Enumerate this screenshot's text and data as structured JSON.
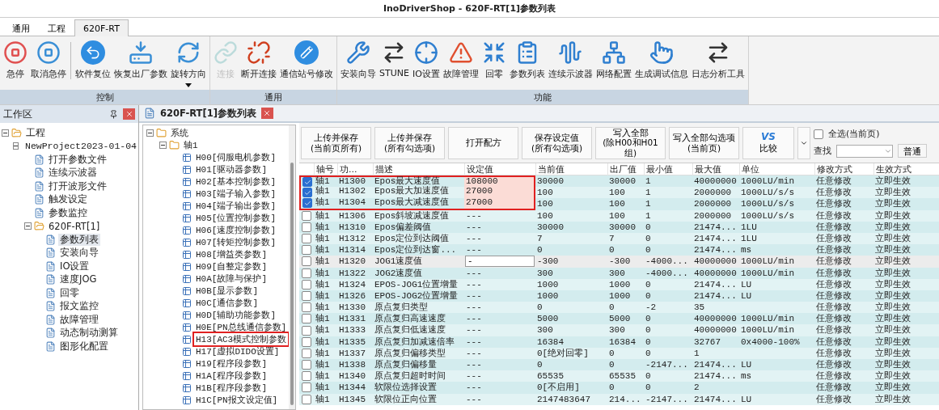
{
  "window": {
    "title": "InoDriverShop - 620F-RT[1]参数列表"
  },
  "menu_tabs": [
    {
      "label": "通用",
      "selected": false
    },
    {
      "label": "工程",
      "selected": false
    },
    {
      "label": "620F-RT",
      "selected": true
    }
  ],
  "ribbon": [
    {
      "label": "控制",
      "items": [
        {
          "label": "急停",
          "disabled": false
        },
        {
          "label": "取消急停",
          "disabled": false
        },
        {
          "label": "软件复位",
          "disabled": false
        },
        {
          "label": "恢复出厂参数",
          "disabled": false
        },
        {
          "label": "旋转方向",
          "disabled": false,
          "menu": true
        }
      ]
    },
    {
      "label": "通用",
      "items": [
        {
          "label": "连接",
          "disabled": true
        },
        {
          "label": "断开连接",
          "disabled": false
        },
        {
          "label": "通信站号修改",
          "disabled": false
        }
      ]
    },
    {
      "label": "功能",
      "items": [
        {
          "label": "安装向导",
          "disabled": false
        },
        {
          "label": "STUNE",
          "disabled": false
        },
        {
          "label": "IO设置",
          "disabled": false
        },
        {
          "label": "故障管理",
          "disabled": false
        },
        {
          "label": "回零",
          "disabled": false
        },
        {
          "label": "参数列表",
          "disabled": false
        },
        {
          "label": "连续示波器",
          "disabled": false
        },
        {
          "label": "网络配置",
          "disabled": false
        },
        {
          "label": "生成调试信息",
          "disabled": false
        },
        {
          "label": "日志分析工具",
          "disabled": false
        }
      ]
    }
  ],
  "workspace": {
    "title": "工作区",
    "tree": [
      {
        "label": "工程",
        "selected": false,
        "expanded": true,
        "children": [
          {
            "label": "NewProject2023-01-04",
            "selected": false,
            "expanded": true,
            "children": [
              {
                "label": "打开参数文件",
                "selected": false
              },
              {
                "label": "连续示波器",
                "selected": false
              },
              {
                "label": "打开波形文件",
                "selected": false
              },
              {
                "label": "触发设定",
                "selected": false
              },
              {
                "label": "参数监控",
                "selected": false
              },
              {
                "label": "620F-RT[1]",
                "selected": false,
                "expanded": true,
                "children": [
                  {
                    "label": "参数列表",
                    "selected": true
                  },
                  {
                    "label": "安装向导",
                    "selected": false
                  },
                  {
                    "label": "IO设置",
                    "selected": false
                  },
                  {
                    "label": "速度JOG",
                    "selected": false
                  },
                  {
                    "label": "回零",
                    "selected": false
                  },
                  {
                    "label": "报文监控",
                    "selected": false
                  },
                  {
                    "label": "故障管理",
                    "selected": false
                  },
                  {
                    "label": "动态制动测算",
                    "selected": false
                  },
                  {
                    "label": "图形化配置",
                    "selected": false
                  }
                ]
              }
            ]
          }
        ]
      }
    ]
  },
  "document": {
    "title": "620F-RT[1]参数列表"
  },
  "group_tree": [
    {
      "label": "系统",
      "expanded": true,
      "marked": false,
      "children": [
        {
          "label": "轴1",
          "expanded": true,
          "marked": false,
          "children": [
            {
              "label": "H00[伺服电机参数]",
              "marked": false
            },
            {
              "label": "H01[驱动器参数]",
              "marked": false
            },
            {
              "label": "H02[基本控制参数]",
              "marked": false
            },
            {
              "label": "H03[端子输入参数]",
              "marked": false
            },
            {
              "label": "H04[端子输出参数]",
              "marked": false
            },
            {
              "label": "H05[位置控制参数]",
              "marked": false
            },
            {
              "label": "H06[速度控制参数]",
              "marked": false
            },
            {
              "label": "H07[转矩控制参数]",
              "marked": false
            },
            {
              "label": "H08[增益类参数]",
              "marked": false
            },
            {
              "label": "H09[自整定参数]",
              "marked": false
            },
            {
              "label": "H0A[故障与保护]",
              "marked": false
            },
            {
              "label": "H0B[显示参数]",
              "marked": false
            },
            {
              "label": "H0C[通信参数]",
              "marked": false
            },
            {
              "label": "H0D[辅助功能参数]",
              "marked": false
            },
            {
              "label": "H0E[PN总线通信参数]",
              "marked": false
            },
            {
              "label": "H13[AC3模式控制参数",
              "marked": true
            },
            {
              "label": "H17[虚拟DIDO设置]",
              "marked": false
            },
            {
              "label": "H19[程序段参数]",
              "marked": false
            },
            {
              "label": "H1A[程序段参数]",
              "marked": false
            },
            {
              "label": "H1B[程序段参数]",
              "marked": false
            },
            {
              "label": "H1C[PN报文设定值]",
              "marked": false
            }
          ]
        }
      ]
    }
  ],
  "actions": [
    "上传并保存\n(当前页所有)",
    "上传并保存\n(所有勾选项)",
    "打开配方",
    "保存设定值\n(所有勾选项)",
    "写入全部\n(除H00和H01组)",
    "写入全部勾选项\n(当前页)"
  ],
  "compare": {
    "logo": "VS",
    "label": "比较"
  },
  "select_all": {
    "label": "全选(当前页)",
    "checked": false
  },
  "search": {
    "label": "查找"
  },
  "mode_button": "普通",
  "table": {
    "columns": [
      "轴号",
      "功...",
      "描述",
      "设定值",
      "当前值",
      "出厂值",
      "最小值",
      "最大值",
      "单位",
      "修改方式",
      "生效方式"
    ],
    "rows": [
      {
        "checked": true,
        "selected": false,
        "modified": true,
        "marked": true,
        "cells": [
          "轴1",
          "H1300",
          "Epos最大速度值",
          "108000",
          "30000",
          "30000",
          "1",
          "40000000",
          "1000LU/min",
          "任意修改",
          "立即生效"
        ]
      },
      {
        "checked": true,
        "selected": false,
        "modified": true,
        "marked": true,
        "cells": [
          "轴1",
          "H1302",
          "Epos最大加速度值",
          "27000",
          "100",
          "100",
          "1",
          "2000000",
          "1000LU/s/s",
          "任意修改",
          "立即生效"
        ]
      },
      {
        "checked": true,
        "selected": false,
        "modified": true,
        "marked": true,
        "cells": [
          "轴1",
          "H1304",
          "Epos最大减速度值",
          "27000",
          "100",
          "100",
          "1",
          "2000000",
          "1000LU/s/s",
          "任意修改",
          "立即生效"
        ]
      },
      {
        "checked": false,
        "selected": false,
        "modified": false,
        "marked": false,
        "cells": [
          "轴1",
          "H1306",
          "Epos斜坡减速度值",
          "---",
          "100",
          "100",
          "1",
          "2000000",
          "1000LU/s/s",
          "任意修改",
          "立即生效"
        ]
      },
      {
        "checked": false,
        "selected": false,
        "modified": false,
        "marked": false,
        "cells": [
          "轴1",
          "H1310",
          "Epos偏差阈值",
          "---",
          "30000",
          "30000",
          "0",
          "21474...",
          "1LU",
          "任意修改",
          "立即生效"
        ]
      },
      {
        "checked": false,
        "selected": false,
        "modified": false,
        "marked": false,
        "cells": [
          "轴1",
          "H1312",
          "Epos定位到达阈值",
          "---",
          "7",
          "7",
          "0",
          "21474...",
          "1LU",
          "任意修改",
          "立即生效"
        ]
      },
      {
        "checked": false,
        "selected": false,
        "modified": false,
        "marked": false,
        "cells": [
          "轴1",
          "H1314",
          "Epos定位到达窗...",
          "---",
          "0",
          "0",
          "0",
          "21474...",
          "ms",
          "任意修改",
          "立即生效"
        ]
      },
      {
        "checked": false,
        "selected": true,
        "modified": false,
        "marked": false,
        "cells": [
          "轴1",
          "H1320",
          "JOG1速度值",
          "-",
          "-300",
          "-300",
          "-4000...",
          "40000000",
          "1000LU/min",
          "任意修改",
          "立即生效"
        ]
      },
      {
        "checked": false,
        "selected": false,
        "modified": false,
        "marked": false,
        "cells": [
          "轴1",
          "H1322",
          "JOG2速度值",
          "---",
          "300",
          "300",
          "-4000...",
          "40000000",
          "1000LU/min",
          "任意修改",
          "立即生效"
        ]
      },
      {
        "checked": false,
        "selected": false,
        "modified": false,
        "marked": false,
        "cells": [
          "轴1",
          "H1324",
          "EPOS-JOG1位置增量",
          "---",
          "1000",
          "1000",
          "0",
          "21474...",
          "LU",
          "任意修改",
          "立即生效"
        ]
      },
      {
        "checked": false,
        "selected": false,
        "modified": false,
        "marked": false,
        "cells": [
          "轴1",
          "H1326",
          "EPOS-JOG2位置增量",
          "---",
          "1000",
          "1000",
          "0",
          "21474...",
          "LU",
          "任意修改",
          "立即生效"
        ]
      },
      {
        "checked": false,
        "selected": false,
        "modified": false,
        "marked": false,
        "cells": [
          "轴1",
          "H1330",
          "原点复归类型",
          "---",
          "0",
          "0",
          "-2",
          "35",
          null,
          "任意修改",
          "立即生效"
        ]
      },
      {
        "checked": false,
        "selected": false,
        "modified": false,
        "marked": false,
        "cells": [
          "轴1",
          "H1331",
          "原点复归高速速度",
          "---",
          "5000",
          "5000",
          "0",
          "40000000",
          "1000LU/min",
          "任意修改",
          "立即生效"
        ]
      },
      {
        "checked": false,
        "selected": false,
        "modified": false,
        "marked": false,
        "cells": [
          "轴1",
          "H1333",
          "原点复归低速速度",
          "---",
          "300",
          "300",
          "0",
          "40000000",
          "1000LU/min",
          "任意修改",
          "立即生效"
        ]
      },
      {
        "checked": false,
        "selected": false,
        "modified": false,
        "marked": false,
        "cells": [
          "轴1",
          "H1335",
          "原点复归加减速倍率",
          "---",
          "16384",
          "16384",
          "0",
          "32767",
          "0x4000-100%",
          "任意修改",
          "立即生效"
        ]
      },
      {
        "checked": false,
        "selected": false,
        "modified": false,
        "marked": false,
        "cells": [
          "轴1",
          "H1337",
          "原点复归偏移类型",
          "---",
          "0[绝对回零]",
          "0",
          "0",
          "1",
          null,
          "任意修改",
          "立即生效"
        ]
      },
      {
        "checked": false,
        "selected": false,
        "modified": false,
        "marked": false,
        "cells": [
          "轴1",
          "H1338",
          "原点复归偏移量",
          "---",
          "0",
          "0",
          "-2147...",
          "21474...",
          "LU",
          "任意修改",
          "立即生效"
        ]
      },
      {
        "checked": false,
        "selected": false,
        "modified": false,
        "marked": false,
        "cells": [
          "轴1",
          "H1340",
          "原点复归超时时间",
          "---",
          "65535",
          "65535",
          "0",
          "21474...",
          "ms",
          "任意修改",
          "立即生效"
        ]
      },
      {
        "checked": false,
        "selected": false,
        "modified": false,
        "marked": false,
        "cells": [
          "轴1",
          "H1344",
          "软限位选择设置",
          "---",
          "0[不启用]",
          "0",
          "0",
          "2",
          null,
          "任意修改",
          "立即生效"
        ]
      },
      {
        "checked": false,
        "selected": false,
        "modified": false,
        "marked": false,
        "cells": [
          "轴1",
          "H1345",
          "软限位正向位置",
          "---",
          "2147483647",
          "214...",
          "-2147...",
          "21474...",
          "LU",
          "任意修改",
          "立即生效"
        ]
      }
    ]
  }
}
